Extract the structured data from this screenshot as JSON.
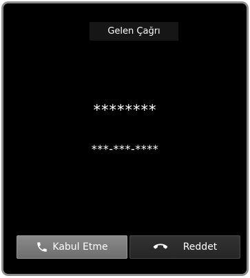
{
  "header": {
    "title": "Gelen Çağrı"
  },
  "caller": {
    "name": "********",
    "number": "***-***-****"
  },
  "actions": {
    "accept_label": "Kabul Etme",
    "accept_icon": "phone-icon",
    "reject_label": "Reddet",
    "reject_icon": "hang-up-icon"
  }
}
